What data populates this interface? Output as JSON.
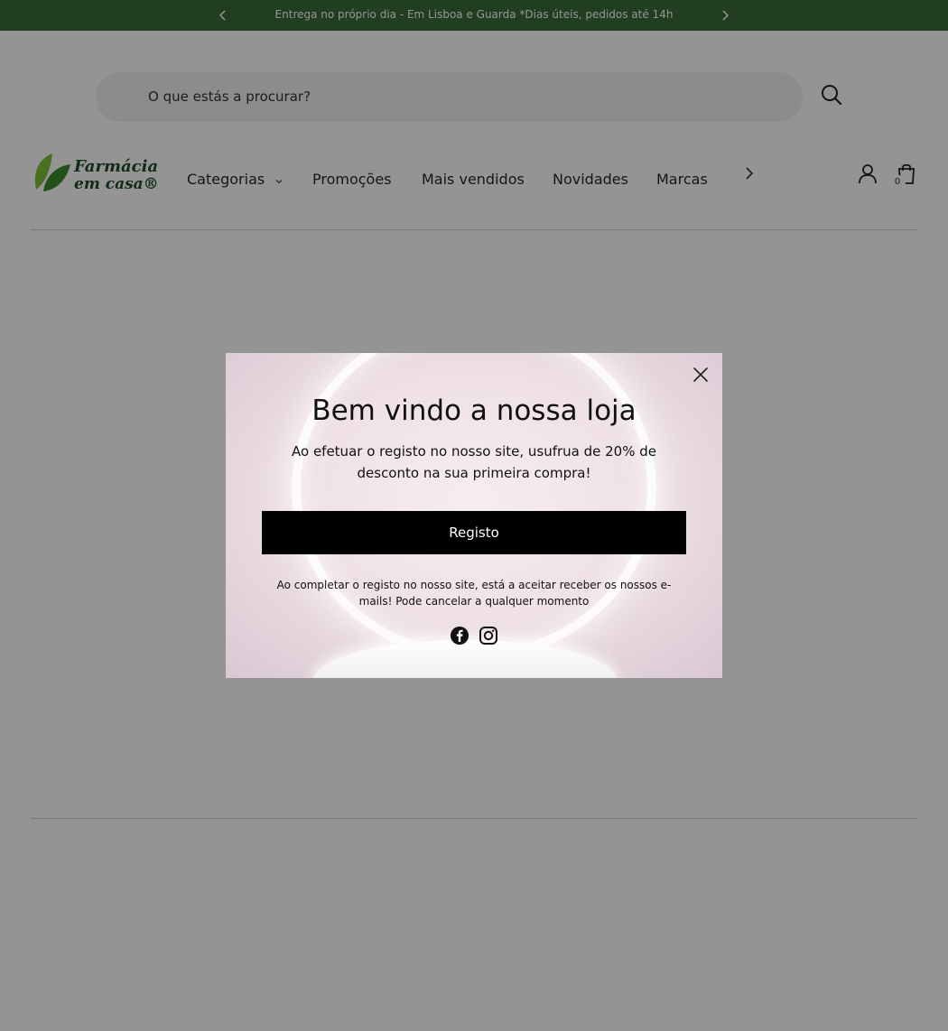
{
  "announcement": {
    "text": "Entrega no próprio dia - Em Lisboa e Guarda *Dias úteis, pedidos até 14h"
  },
  "search": {
    "placeholder": "O que estás a procurar?"
  },
  "logo": {
    "line1": "Farmácia",
    "line2": "em casa®"
  },
  "nav": {
    "items": [
      {
        "label": "Categorias"
      },
      {
        "label": "Promoções"
      },
      {
        "label": "Mais vendidos"
      },
      {
        "label": "Novidades"
      },
      {
        "label": "Marcas"
      }
    ]
  },
  "cart": {
    "count": "0"
  },
  "popup": {
    "title": "Bem vindo a nossa loja",
    "subtitle": "Ao efetuar o registo no nosso site, usufrua de 20% de desconto na sua primeira compra!",
    "button_label": "Registo",
    "fine_print": "Ao completar o registo no nosso site, está a aceitar receber os nossos e-mails! Pode cancelar a qualquer momento",
    "socials": [
      "facebook-icon",
      "instagram-icon"
    ]
  },
  "colors": {
    "announcement_bg": "#3a6b39",
    "button_bg": "#000000",
    "brand_green": "#1c4a2a"
  }
}
